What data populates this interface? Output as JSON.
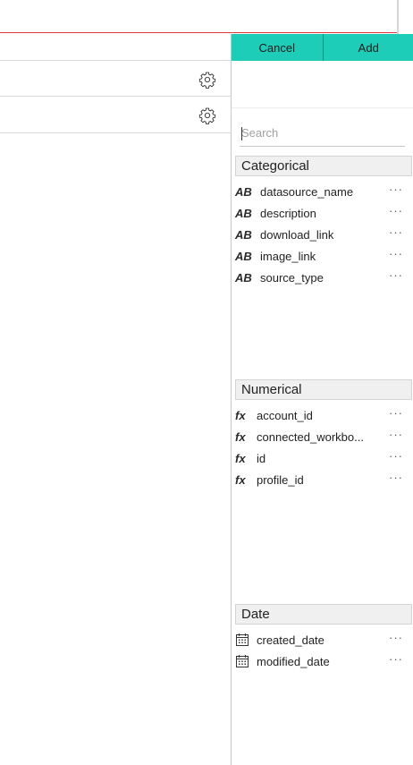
{
  "actions": {
    "cancel_label": "Cancel",
    "add_label": "Add"
  },
  "search": {
    "placeholder": "Search",
    "value": ""
  },
  "sections": {
    "categorical": {
      "title": "Categorical",
      "type_label": "AB",
      "fields": [
        "datasource_name",
        "description",
        "download_link",
        "image_link",
        "source_type"
      ]
    },
    "numerical": {
      "title": "Numerical",
      "type_label": "fx",
      "fields": [
        "account_id",
        "connected_workbo...",
        "id",
        "profile_id"
      ]
    },
    "date": {
      "title": "Date",
      "type_icon": "calendar-icon",
      "fields": [
        "created_date",
        "modified_date"
      ]
    }
  },
  "more_label": "···",
  "icons": {
    "row_settings": "gear-icon"
  },
  "colors": {
    "accent": "#1ecdb8",
    "top_border": "#e0383e"
  }
}
